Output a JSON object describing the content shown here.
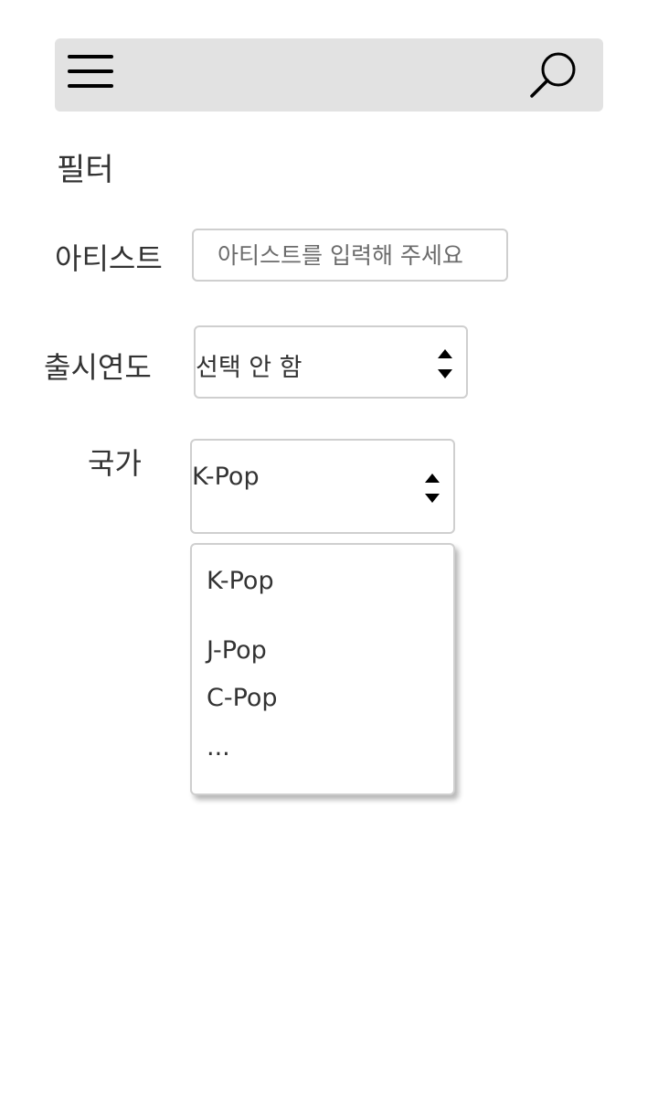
{
  "header": {
    "menu_icon": "hamburger-menu-icon",
    "search_icon": "search-icon",
    "background": "#e2e2e2"
  },
  "filter": {
    "title": "필터",
    "artist": {
      "label": "아티스트",
      "placeholder": "아티스트를 입력해 주세요",
      "value": ""
    },
    "release_year": {
      "label": "출시연도",
      "selected": "선택 안 함"
    },
    "country": {
      "label": "국가",
      "selected": "K-Pop",
      "options": [
        "K-Pop",
        "J-Pop",
        "C-Pop",
        "..."
      ]
    }
  }
}
